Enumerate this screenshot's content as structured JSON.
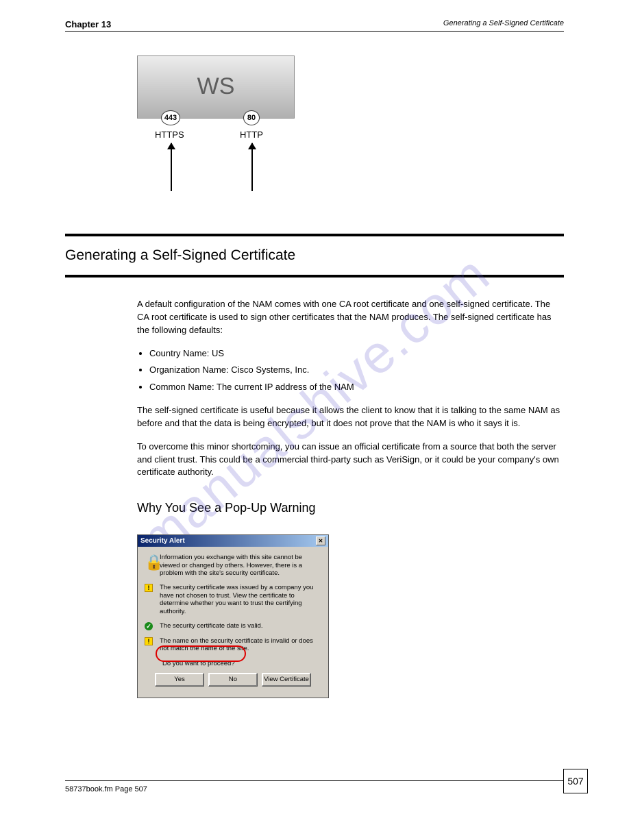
{
  "watermark": "manualshive.com",
  "header": {
    "left": "Chapter 13",
    "right": "Generating a Self-Signed Certificate"
  },
  "diagram": {
    "title": "WS",
    "port_left": "443",
    "port_right": "80",
    "proto_left": "HTTPS",
    "proto_right": "HTTP"
  },
  "section_title": "Generating a Self-Signed Certificate",
  "body": {
    "p1": "A default configuration of the NAM comes with one CA root certificate and one self-signed certificate. The CA root certificate is used to sign other certificates that the NAM produces. The self-signed certificate has the following defaults:",
    "b1": "Country Name: US",
    "b2": "Organization Name: Cisco Systems, Inc.",
    "b3": "Common Name: The current IP address of the NAM",
    "p2": "The self-signed certificate is useful because it allows the client to know that it is talking to the same NAM as before and that the data is being encrypted, but it does not prove that the NAM is who it says it is.",
    "p3": "To overcome this minor shortcoming, you can issue an official certificate from a source that both the server and client trust. This could be a commercial third-party such as VeriSign, or it could be your company's own certificate authority."
  },
  "subhead": "Why You See a Pop-Up Warning",
  "dialog": {
    "title": "Security Alert",
    "intro": "Information you exchange with this site cannot be viewed or changed by others. However, there is a problem with the site's security certificate.",
    "msg1": "The security certificate was issued by a company you have not chosen to trust. View the certificate to determine whether you want to trust the certifying authority.",
    "msg2": "The security certificate date is valid.",
    "msg3": "The name on the security certificate is invalid or does not match the name of the site.",
    "question": "Do you want to proceed?",
    "yes": "Yes",
    "no": "No",
    "view": "View Certificate"
  },
  "footer": {
    "doc": "58737book.fm Page 507",
    "page": "507"
  }
}
